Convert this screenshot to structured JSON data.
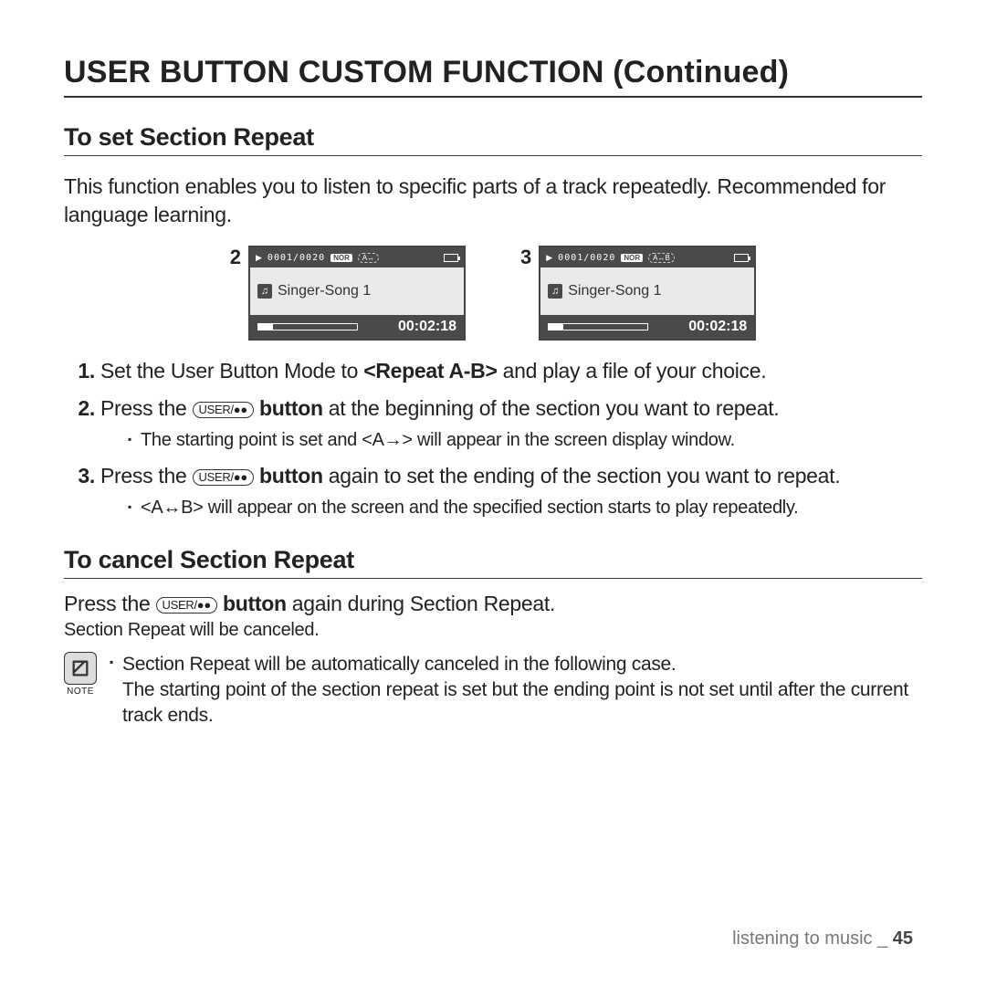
{
  "title": "USER BUTTON CUSTOM FUNCTION (Continued)",
  "section1": {
    "heading": "To set Section Repeat",
    "intro": "This function enables you to listen to specific parts of a track repeatedly. Recommended for language learning."
  },
  "screens": [
    {
      "num": "2",
      "counter": "0001/0020",
      "mode": "NOR",
      "repeat": "A↔",
      "song": "Singer-Song 1",
      "time": "00:02:18"
    },
    {
      "num": "3",
      "counter": "0001/0020",
      "mode": "NOR",
      "repeat": "A↔B",
      "song": "Singer-Song 1",
      "time": "00:02:18"
    }
  ],
  "steps": {
    "s1a": "Set the User Button Mode to ",
    "s1b": "<Repeat A-B>",
    "s1c": " and play a file of your choice.",
    "s2a": "Press the ",
    "s2b": " button",
    "s2c": " at the beginning of the section you want to repeat.",
    "s2sub": "The starting point is set and <A→> will appear in the screen display window.",
    "s3a": "Press the ",
    "s3b": " button",
    "s3c": " again to set the ending of the section you want to repeat.",
    "s3sub": "<A↔B> will appear on the screen and the specified section starts to play repeatedly."
  },
  "userbtn": "USER/●●",
  "section2": {
    "heading": "To cancel Section Repeat",
    "line1a": "Press the ",
    "line1b": " button",
    "line1c": " again during Section Repeat.",
    "line2": "Section Repeat will be canceled."
  },
  "note": {
    "label": "NOTE",
    "bullet": "Section Repeat will be automatically canceled in the following case.",
    "cont": "The starting point of the section repeat is set but the ending point is not set until after the current track ends."
  },
  "footer": {
    "section": "listening to music _ ",
    "page": "45"
  }
}
